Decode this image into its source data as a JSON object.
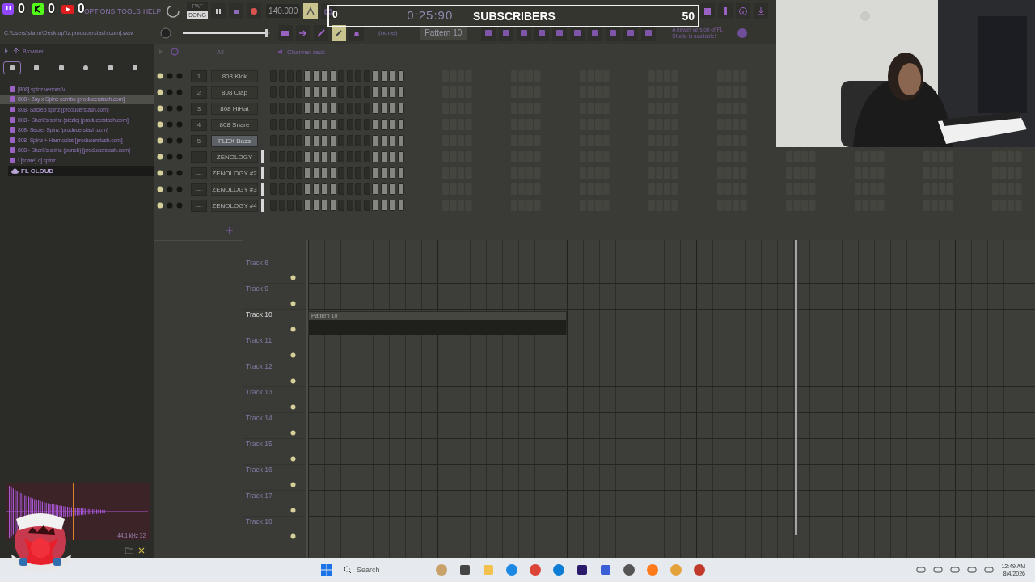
{
  "stream_overlay": {
    "counters": [
      {
        "kind": "twitch",
        "count": "0"
      },
      {
        "kind": "kick",
        "count": "0"
      },
      {
        "kind": "youtube",
        "count": "0"
      }
    ]
  },
  "subscribers": {
    "current": "0",
    "label": "SUBSCRIBERS",
    "goal": "50"
  },
  "toolbar": {
    "menu": [
      "OPTIONS",
      "TOOLS",
      "HELP"
    ],
    "hint": "C:\\Users\\starm\\Desktop\\!z.producerstash.com].wav",
    "modes": [
      {
        "label": "PAT",
        "selected": false
      },
      {
        "label": "SONG",
        "selected": true
      }
    ],
    "tempo": "140.000",
    "time": "0:25:90",
    "master_volume": {
      "level": 0.95
    },
    "channel_filter": "(none)",
    "pattern": "Pattern 10",
    "notice": "A newer version of FL Studio is available!"
  },
  "browser": {
    "title": "Browser",
    "items": [
      {
        "label": "[808] spinz venom V",
        "selected": false
      },
      {
        "label": "808 - Zay x Spinz combo [producerstash.com]",
        "selected": true
      },
      {
        "label": "808- Sacred spinz [producerstash.com]",
        "selected": false
      },
      {
        "label": "808 - Shark's spinz (sizzle) [producerstash.com]",
        "selected": false
      },
      {
        "label": "808- Secret Spinz [producerstash.com]",
        "selected": false
      },
      {
        "label": "808- Spinz + Harmocics [producerstash.com]",
        "selected": false
      },
      {
        "label": "808 - Shark's spinz (punch) [producerstash.com]",
        "selected": false
      },
      {
        "label": "! [snare] dj spinz",
        "selected": false
      }
    ],
    "cloud": "FL CLOUD",
    "preview_info": "44.1 kHz 32"
  },
  "channel_rack": {
    "filter": "All",
    "title": "Channel rack",
    "channels": [
      {
        "kind": "sample",
        "number": "1",
        "name": "808 Kick",
        "selected": false
      },
      {
        "kind": "sample",
        "number": "2",
        "name": "808 Clap",
        "selected": false
      },
      {
        "kind": "sample",
        "number": "3",
        "name": "808 HiHat",
        "selected": false
      },
      {
        "kind": "sample",
        "number": "4",
        "name": "808 Snare",
        "selected": false
      },
      {
        "kind": "sample",
        "number": "5",
        "name": "FLEX Bass",
        "selected": true
      },
      {
        "kind": "plugin",
        "number": "---",
        "name": "ZENOLOGY",
        "selected": false
      },
      {
        "kind": "plugin",
        "number": "---",
        "name": "ZENOLOGY #2",
        "selected": false
      },
      {
        "kind": "plugin",
        "number": "---",
        "name": "ZENOLOGY #3",
        "selected": false
      },
      {
        "kind": "plugin",
        "number": "---",
        "name": "ZENOLOGY #4",
        "selected": false
      }
    ]
  },
  "playlist": {
    "tracks": [
      {
        "name": "Track 8",
        "active": false
      },
      {
        "name": "Track 9",
        "active": false
      },
      {
        "name": "Track 10",
        "active": true,
        "clips": [
          {
            "name": "Pattern 10"
          }
        ]
      },
      {
        "name": "Track 11",
        "active": false
      },
      {
        "name": "Track 12",
        "active": false
      },
      {
        "name": "Track 13",
        "active": false
      },
      {
        "name": "Track 14",
        "active": false
      },
      {
        "name": "Track 15",
        "active": false
      },
      {
        "name": "Track 16",
        "active": false
      },
      {
        "name": "Track 17",
        "active": false
      },
      {
        "name": "Track 18",
        "active": false
      }
    ]
  },
  "taskbar": {
    "search": "Search",
    "time": "12:49 AM",
    "date": "8/4/2026"
  }
}
